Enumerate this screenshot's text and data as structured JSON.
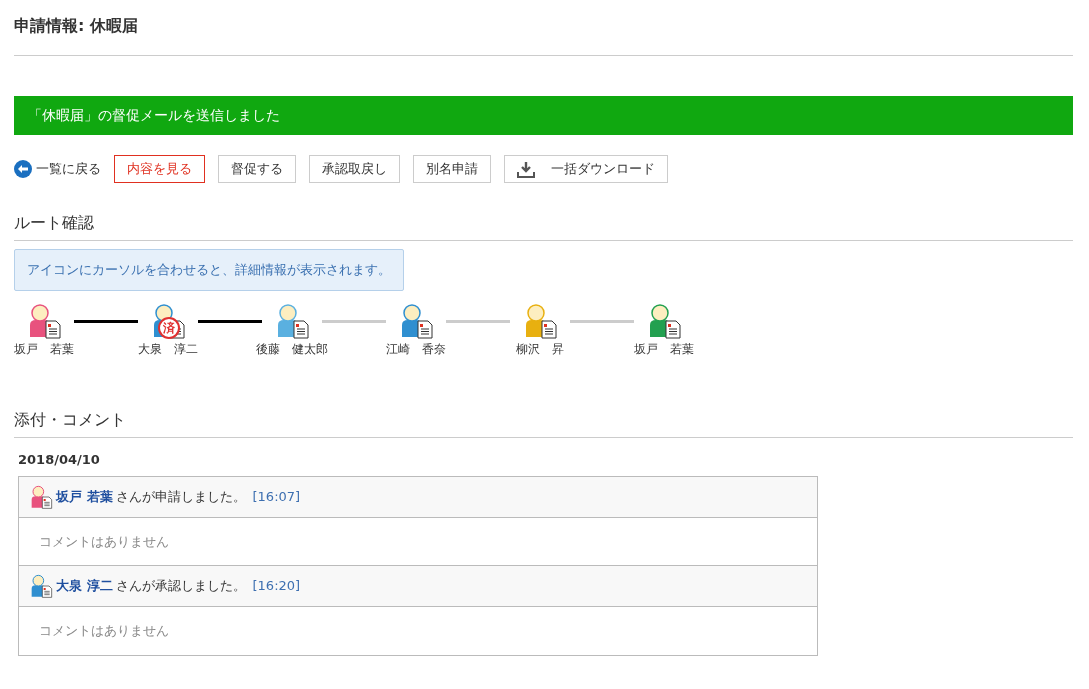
{
  "page_title": "申請情報: 休暇届",
  "alert": "「休暇届」の督促メールを送信しました",
  "actions": [
    {
      "kind": "back",
      "label": "一覧に戻る"
    },
    {
      "kind": "primary",
      "label": "内容を見る"
    },
    {
      "kind": "plain",
      "label": "督促する"
    },
    {
      "kind": "plain",
      "label": "承認取戻し"
    },
    {
      "kind": "plain",
      "label": "別名申請"
    },
    {
      "kind": "download",
      "label": "一括ダウンロード"
    }
  ],
  "route": {
    "heading": "ルート確認",
    "hint": "アイコンにカーソルを合わせると、詳細情報が表示されます。",
    "nodes": [
      {
        "name": "坂戸　若葉",
        "color": "#e8527e"
      },
      {
        "name": "大泉　淳二",
        "color": "#2f8fd0",
        "stamp": "済"
      },
      {
        "name": "後藤　健太郎",
        "color": "#5ab0e0"
      },
      {
        "name": "江崎　香奈",
        "color": "#2f8fd0"
      },
      {
        "name": "柳沢　昇",
        "color": "#e8b010"
      },
      {
        "name": "坂戸　若葉",
        "color": "#22a050"
      }
    ],
    "connectors": [
      {
        "completed": true
      },
      {
        "completed": true
      },
      {
        "completed": false
      },
      {
        "completed": false
      },
      {
        "completed": false
      }
    ]
  },
  "comments": {
    "heading": "添付・コメント",
    "date": "2018/04/10",
    "entries": [
      {
        "name": "坂戸 若葉",
        "color": "#e8527e",
        "action": "さんが申請しました。",
        "time": "[16:07]",
        "comment": "コメントはありません"
      },
      {
        "name": "大泉 淳二",
        "color": "#2f8fd0",
        "action": "さんが承認しました。",
        "time": "[16:20]",
        "comment": "コメントはありません"
      }
    ]
  }
}
